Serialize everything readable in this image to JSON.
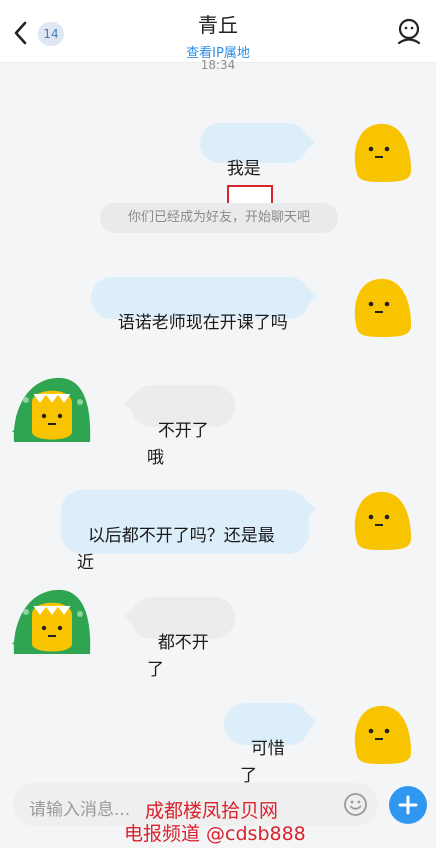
{
  "header": {
    "title": "青丘",
    "unread_count": "14",
    "ip_link": "查看IP属地",
    "time": "18:34"
  },
  "messages": [
    {
      "side": "right",
      "text": "我是"
    },
    {
      "side": "system",
      "text": "你们已经成为好友，开始聊天吧"
    },
    {
      "side": "right",
      "text": "语诺老师现在开课了吗"
    },
    {
      "side": "left",
      "text": "不开了哦"
    },
    {
      "side": "right",
      "text": "以后都不开了吗？还是最\n近"
    },
    {
      "side": "left",
      "text": "都不开了"
    },
    {
      "side": "right",
      "text": "可惜了"
    }
  ],
  "input": {
    "placeholder": "请输入消息..."
  },
  "watermark": {
    "line1": "成都楼凤拾贝网",
    "line2": "电报频道 @cdsb888"
  },
  "colors": {
    "accent": "#2f97ef",
    "bubble_self": "#dceefa",
    "bubble_other": "#ececec",
    "watermark": "#d9232d"
  },
  "icons": [
    "back-arrow-icon",
    "profile-icon",
    "emoji-icon",
    "plus-icon",
    "yellow-blob-avatar",
    "green-dinosaur-avatar"
  ]
}
